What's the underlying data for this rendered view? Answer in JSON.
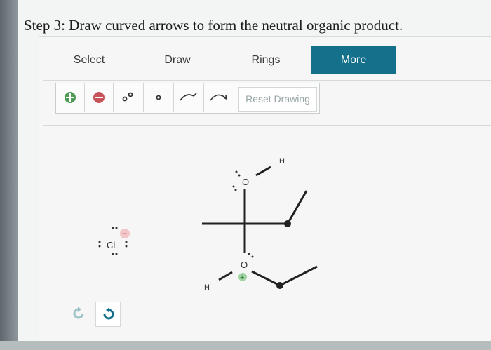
{
  "prompt": "Step 3: Draw curved arrows to form the neutral organic product.",
  "tabs": [
    {
      "label": "Select",
      "active": false
    },
    {
      "label": "Draw",
      "active": false
    },
    {
      "label": "Rings",
      "active": false
    },
    {
      "label": "More",
      "active": true
    }
  ],
  "toolbar": {
    "reset_label": "Reset Drawing",
    "tools": [
      "plus-charge-icon",
      "minus-charge-icon",
      "radical-pair-icon",
      "single-electron-icon",
      "curved-arrow-single-icon",
      "curved-arrow-double-icon"
    ]
  },
  "molecule": {
    "chloride_label": "Cl",
    "chloride_charge": "−",
    "top_oxygen": "O",
    "top_h": "H",
    "bottom_oxygen": "O",
    "bottom_h": "H",
    "bottom_charge": "+"
  },
  "controls": {
    "undo": "undo-icon",
    "redo": "redo-icon"
  },
  "colors": {
    "accent": "#15708c",
    "plus": "#4c9a54",
    "minus": "#c8525a"
  }
}
